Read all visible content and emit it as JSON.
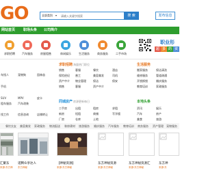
{
  "header": {
    "logo_text": "GO",
    "search_category": "全部类别",
    "search_placeholder": "请输入关键字搜索",
    "search_button": "搜 索",
    "post_button": "发布信息"
  },
  "nav": [
    "网站首页",
    "职场头条",
    "公司简介"
  ],
  "categories": [
    {
      "label": "求职招聘",
      "color": "#f0a030"
    },
    {
      "label": "汽车服务",
      "color": "#f06a5a"
    },
    {
      "label": "房屋租售",
      "color": "#e55a4a"
    },
    {
      "label": "休闲娱乐",
      "color": "#3aa6e0"
    },
    {
      "label": "生活服务",
      "color": "#4f8fd8"
    },
    {
      "label": "商务服务",
      "color": "#f08a30"
    },
    {
      "label": "二手市场",
      "color": "#3aa53a"
    }
  ],
  "promo": {
    "title": "职业形",
    "tags": [
      {
        "text": "超",
        "color": "#e55a4a"
      },
      {
        "text": "多",
        "color": "#f08a30"
      },
      {
        "text": "的",
        "color": "#3aa53a"
      },
      {
        "text": "资",
        "color": "#4f8fd8"
      },
      {
        "text": "源",
        "color": "#9a5ad8"
      }
    ]
  },
  "left_col": {
    "heading": "",
    "rows": [
      [
        "",
        "",
        ""
      ],
      [
        "车找人",
        "宠物狗",
        "园林苗"
      ],
      [
        "",
        "",
        ""
      ],
      [
        "手机",
        "二手",
        "装修"
      ],
      [
        "",
        "",
        ""
      ],
      [
        "SUV",
        "MPV",
        "皮卡"
      ],
      [
        "租车服务",
        "汽车改装",
        ""
      ],
      [
        "",
        "",
        ""
      ],
      [
        "找工作",
        "信息咨询",
        "店铺转让"
      ]
    ]
  },
  "middle_col": {
    "heading": "求职招聘",
    "heading_sub": "海量热门职位",
    "rows": [
      [
        "销售",
        "客服",
        "餐饮",
        "酒店"
      ],
      [
        "保险经纪",
        "普工",
        "美容美发",
        "司机"
      ],
      [
        "资产中介",
        "物业管理",
        "保洁",
        "保安"
      ]
    ],
    "heading2": "同城房产",
    "heading2_sub": "房源更新每日",
    "rows2": [
      [
        "二手房",
        "出租",
        "租房",
        "求租"
      ],
      [
        "新房",
        "短租",
        "商铺",
        "写字楼"
      ],
      [
        "厂房",
        "仓库",
        "土地",
        "车位"
      ]
    ],
    "extra_rows": [
      [
        "销售",
        "客服",
        "资产中介"
      ],
      [
        "",
        "",
        ""
      ]
    ]
  },
  "right_col": {
    "heading": "生活服务",
    "rows": [
      [
        "搬家服务",
        "保洁清洗"
      ],
      [
        "维修服务",
        "管道疏通"
      ],
      [
        "开锁换锁",
        "婚庆服务"
      ],
      [
        "教育培训",
        "家政服务"
      ]
    ],
    "heading2": "本地头条",
    "rows2": [
      [
        "资讯",
        "娱乐"
      ],
      [
        "汽车",
        "房产"
      ],
      [
        "美食",
        "旅游"
      ]
    ]
  },
  "link_strip": [
    "餐饮交友",
    "美容美发",
    "家政服务",
    "物流配送",
    "装修建材",
    "旅游服务",
    "婚庆服务",
    "汽车服务",
    "教育培训",
    "商务服务",
    "资产管理",
    "宠物服务"
  ],
  "thumbs": [
    {
      "caption": "汇聚东",
      "meta": "来源:东方神"
    },
    {
      "caption": "诺腾众享达人",
      "meta": "东方神秘"
    },
    {
      "caption": "【神秘资源】",
      "meta": "来源:东方神秘"
    },
    {
      "caption": "东方神秘资源",
      "meta": "来源:东方神秘"
    },
    {
      "caption": "东方神秘资源汇",
      "meta": "来源:东方神秘"
    },
    {
      "caption": "东方神",
      "meta": "来源:东"
    }
  ]
}
